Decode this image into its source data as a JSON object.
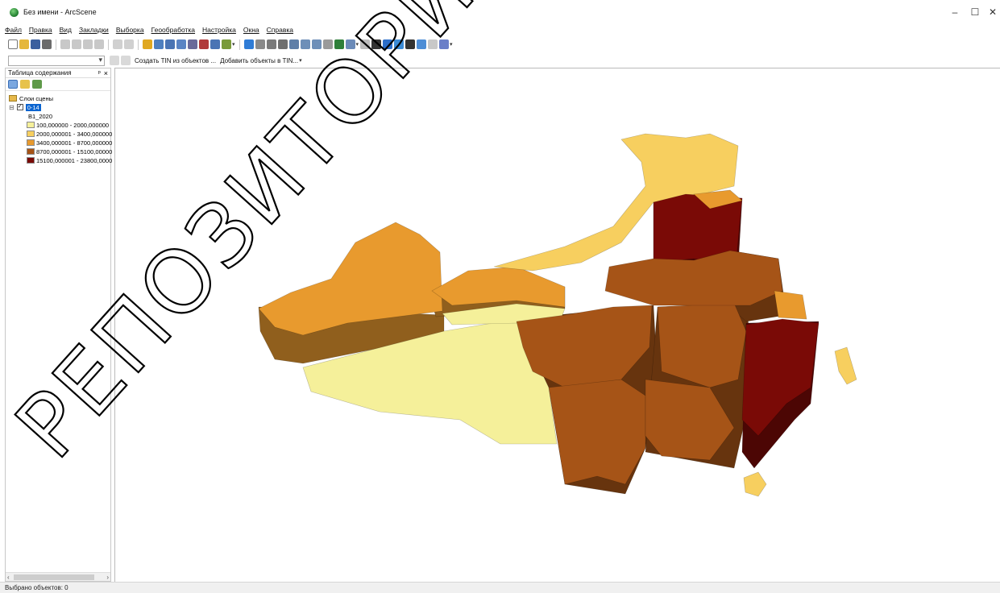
{
  "window": {
    "title": "Без имени - ArcScene",
    "minimize": "–",
    "maximize": "☐",
    "close": "✕"
  },
  "menu": [
    "Файл",
    "Правка",
    "Вид",
    "Закладки",
    "Выборка",
    "Геообработка",
    "Настройка",
    "Окна",
    "Справка"
  ],
  "toolbar3d": {
    "create_tin": "Создать TIN из объектов ...",
    "add_features_tin": "Добавить объекты в TIN..."
  },
  "toc": {
    "title": "Таблица содержания",
    "pin": "ᵖ",
    "close": "×",
    "root": "Слои сцены",
    "layer": "0-14",
    "field": "B1_2020",
    "classes": [
      {
        "label": "100,000000 - 2000,000000",
        "color": "#f5f09a"
      },
      {
        "label": "2000,000001 - 3400,000000",
        "color": "#f7cf5f"
      },
      {
        "label": "3400,000001 - 8700,000000",
        "color": "#e89a2e"
      },
      {
        "label": "8700,000001 - 15100,00000",
        "color": "#a65417"
      },
      {
        "label": "15100,000001 - 23800,0000",
        "color": "#7a0a06"
      }
    ]
  },
  "scroll": {
    "left": "‹",
    "right": "›"
  },
  "watermark": "РЕПОЗИТОРИЙ ГГУ",
  "status": {
    "text": "Выбрано объектов: 0"
  },
  "icons": [
    "arcscene-icon",
    "new-icon",
    "open-icon",
    "save-icon",
    "print-icon",
    "cut-icon",
    "copy-icon",
    "paste-icon",
    "delete-icon",
    "undo-icon",
    "redo-icon",
    "add-data-icon",
    "navigate-icon",
    "zoom-in-icon",
    "zoom-out-icon",
    "pan-icon",
    "full-extent-icon",
    "identify-icon",
    "find-icon",
    "layers-icon"
  ]
}
